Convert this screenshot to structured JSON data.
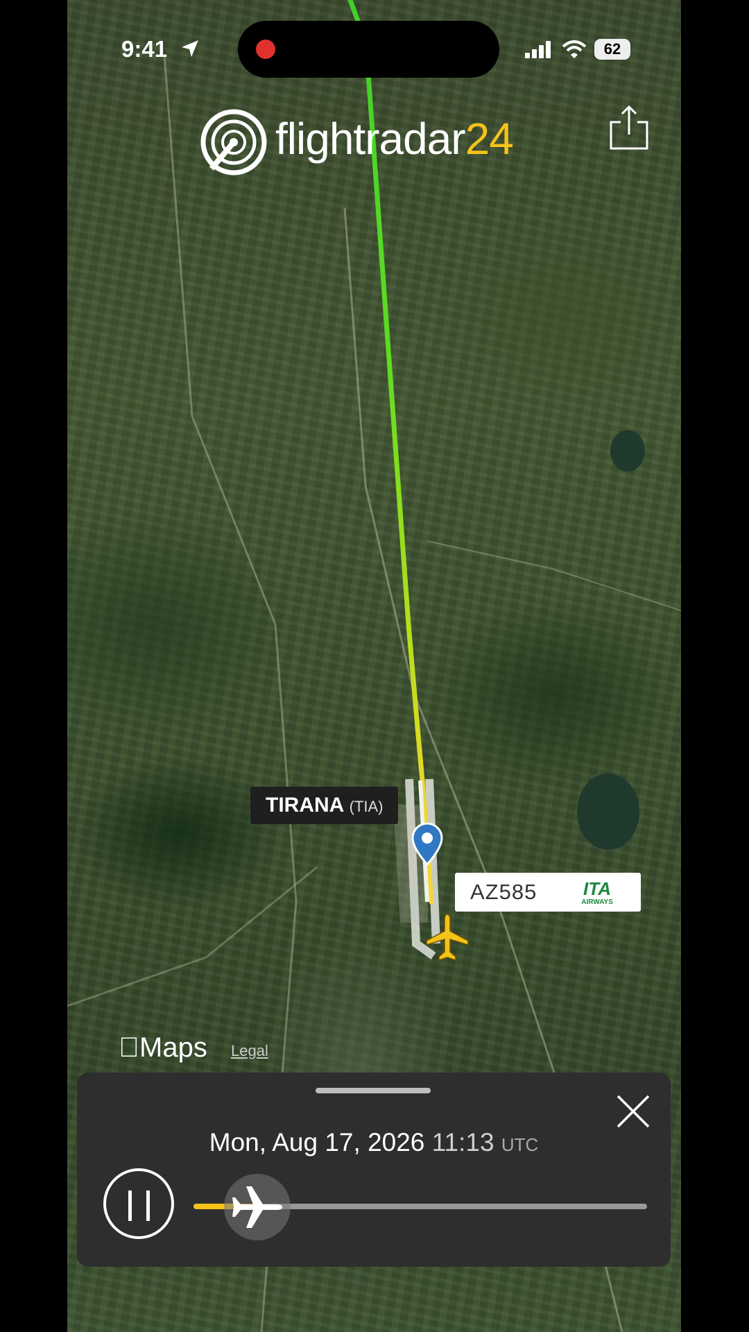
{
  "status_bar": {
    "time": "9:41",
    "battery": "62"
  },
  "brand": {
    "name_main": "flightradar",
    "name_num": "24"
  },
  "map": {
    "airport_label": {
      "name": "TIRANA",
      "code": "(TIA)"
    },
    "flight_label": {
      "number": "AZ585",
      "airline_logo_text": "ITA",
      "airline_sub": "AIRWAYS"
    },
    "attribution": {
      "maps": "Maps",
      "legal": "Legal"
    }
  },
  "playback": {
    "date": "Mon, Aug 17, 2026",
    "time": "11:13",
    "timezone": "UTC",
    "progress": 0.15,
    "colors": {
      "progress": "#f4c31a",
      "track": "#9a9a9a"
    }
  },
  "icons": [
    "location-arrow-icon",
    "signal-icon",
    "wifi-icon",
    "battery-icon",
    "radar-logo-icon",
    "share-icon",
    "pin-icon",
    "plane-icon",
    "close-icon",
    "pause-icon"
  ]
}
